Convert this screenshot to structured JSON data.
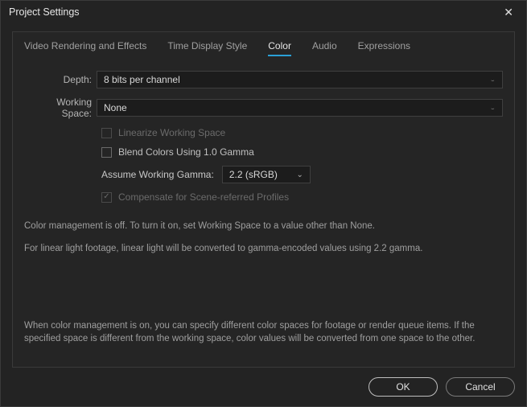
{
  "title": "Project Settings",
  "tabs": {
    "video": "Video Rendering and Effects",
    "time": "Time Display Style",
    "color": "Color",
    "audio": "Audio",
    "expr": "Expressions"
  },
  "labels": {
    "depth": "Depth:",
    "workingSpace": "Working Space:",
    "assumeGamma": "Assume Working Gamma:"
  },
  "values": {
    "depth": "8 bits per channel",
    "workingSpace": "None",
    "assumeGamma": "2.2 (sRGB)"
  },
  "checkboxes": {
    "linearize": "Linearize Working Space",
    "blend": "Blend Colors Using 1.0 Gamma",
    "compensate": "Compensate for Scene-referred Profiles"
  },
  "info": {
    "line1": "Color management is off. To turn it on, set Working Space to a value other than None.",
    "line2": "For linear light footage, linear light will be converted to gamma-encoded values using 2.2 gamma.",
    "bottom": "When color management is on, you can specify different color spaces for footage or render queue items. If the specified space is different from the working space, color values will be converted from one space to the other."
  },
  "buttons": {
    "ok": "OK",
    "cancel": "Cancel"
  }
}
